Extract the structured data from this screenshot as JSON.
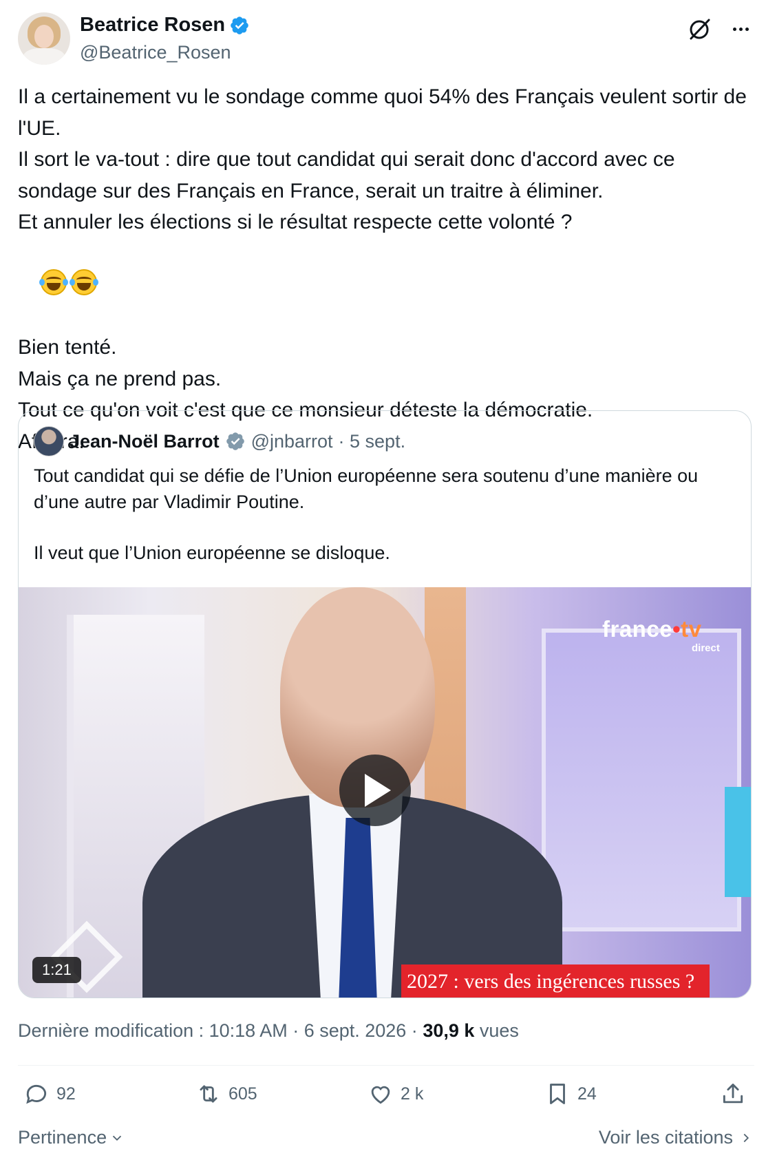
{
  "author": {
    "display_name": "Beatrice Rosen",
    "handle": "@Beatrice_Rosen",
    "verified": true
  },
  "tweet": {
    "lines": [
      "Il a certainement vu le sondage comme quoi 54% des Français veulent sortir de l'UE.",
      "Il sort le va-tout : dire que tout candidat qui serait donc d'accord avec ce sondage sur des Français en France, serait un traitre à éliminer.",
      "Et annuler les élections si le résultat respecte cette volonté ?",
      "Bien tenté.",
      "Mais ça ne prend pas.",
      "Tout ce qu'on voit c'est que ce monsieur déteste la démocratie.",
      "Afuera."
    ],
    "emoji_names": [
      "face-with-tears-of-joy-icon",
      "face-with-tears-of-joy-icon"
    ]
  },
  "quoted": {
    "display_name": "Jean-Noël Barrot",
    "handle": "@jnbarrot",
    "date": "· 5 sept.",
    "text_paragraphs": [
      "Tout candidat qui se défie de l’Union européenne sera soutenu d’une manière ou d’une autre par Vladimir Poutine.",
      "Il veut que l’Union européenne se disloque."
    ],
    "video": {
      "duration": "1:21",
      "channel_logo": "france•tv",
      "channel_sub": "direct",
      "chyron": "2027 : vers des ingérences russes ?"
    }
  },
  "meta": {
    "prefix": "Dernière modification : 10:18 AM · 6 sept. 2026 · ",
    "views_count": "30,9 k",
    "views_label": " vues"
  },
  "actions": {
    "replies": "92",
    "reposts": "605",
    "likes": "2 k",
    "bookmarks": "24"
  },
  "footer": {
    "sort_label": "Pertinence",
    "quotes_label": "Voir les citations"
  },
  "colors": {
    "verified": "#1d9bf0",
    "verified_gray": "#829aab",
    "muted_text": "#536471",
    "chyron_red": "#e3242b"
  }
}
